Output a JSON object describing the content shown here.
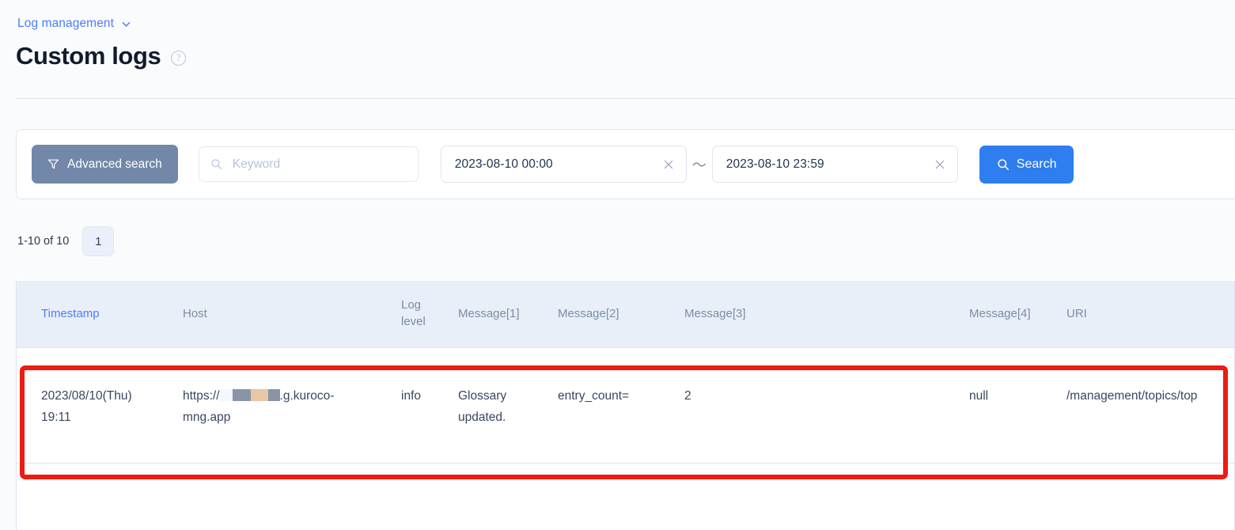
{
  "breadcrumb": {
    "label": "Log management",
    "chevron_icon": "chevron-down-icon"
  },
  "header": {
    "title": "Custom logs",
    "help_icon": "help-circle-icon"
  },
  "search_panel": {
    "advanced_search_label": "Advanced search",
    "advanced_search_icon": "filter-funnel-icon",
    "advanced_search_bg": "#7388a8",
    "keyword": {
      "value": "",
      "placeholder": "Keyword",
      "icon": "search-icon"
    },
    "date_from": {
      "value": "2023-08-10 00:00",
      "clear_icon": "close-icon"
    },
    "range_separator": "～",
    "date_to": {
      "value": "2023-08-10 23:59",
      "clear_icon": "close-icon"
    },
    "search_button": {
      "label": "Search",
      "icon": "search-icon",
      "bg": "#2e7ef0"
    }
  },
  "pagination": {
    "range_label": "1-10 of 10",
    "current_page": "1"
  },
  "table": {
    "columns": [
      {
        "label": "Timestamp",
        "sortable": true
      },
      {
        "label": "Host",
        "sortable": false
      },
      {
        "label": "Log level",
        "sortable": false
      },
      {
        "label": "Message[1]",
        "sortable": false
      },
      {
        "label": "Message[2]",
        "sortable": false
      },
      {
        "label": "Message[3]",
        "sortable": false
      },
      {
        "label": "Message[4]",
        "sortable": false
      },
      {
        "label": "URI",
        "sortable": false
      }
    ],
    "rows": [
      {
        "timestamp": "2023/08/10(Thu) 19:11",
        "host_prefix": "https://",
        "host_suffix": ".g.kuroco-mng.app",
        "host_redacted": true,
        "log_level": "info",
        "message_1": "Glossary updated.",
        "message_2": "entry_count=",
        "message_3": "2",
        "message_4": "null",
        "uri": "/management/topics/top"
      }
    ]
  },
  "annotation": {
    "highlight_color": "#ec1c12",
    "target": "first-table-row"
  }
}
